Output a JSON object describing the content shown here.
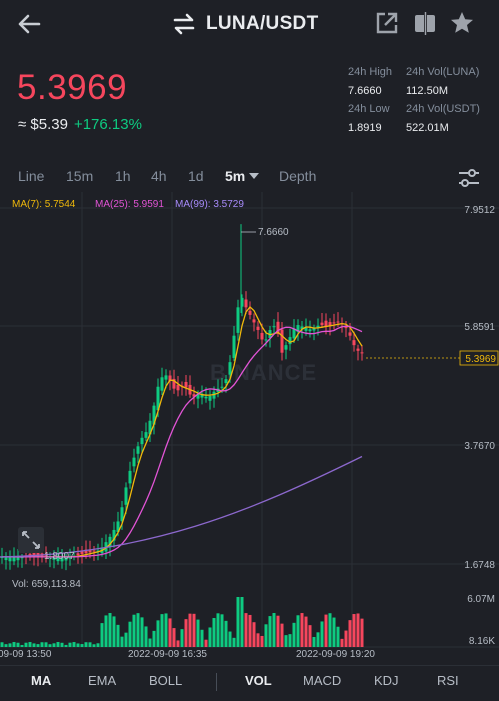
{
  "header": {
    "pair": "LUNA/USDT"
  },
  "ticker": {
    "price": "5.3969",
    "usd_approx": "≈ $5.39",
    "change": "+176.13%",
    "stats": [
      {
        "label": "24h High",
        "value": "7.6660"
      },
      {
        "label": "24h Vol(LUNA)",
        "value": "112.50M"
      },
      {
        "label": "24h Low",
        "value": "1.8919"
      },
      {
        "label": "24h Vol(USDT)",
        "value": "522.01M"
      }
    ]
  },
  "intervals": [
    "Line",
    "15m",
    "1h",
    "4h",
    "1d",
    "5m",
    "Depth"
  ],
  "active_interval": "5m",
  "chart_data": {
    "type": "candlestick",
    "ma_labels": [
      "MA(7): 5.7544",
      "MA(25): 5.9591",
      "MA(99): 3.5729"
    ],
    "price_axis": [
      "7.9512",
      "5.8591",
      "3.7670",
      "1.6748"
    ],
    "current_price_tag": "5.3969",
    "high_marker": "7.6660",
    "low_marker": "1.8007",
    "volume_label": "Vol: 659,113.84",
    "volume_axis": [
      "6.07M",
      "8.16K"
    ],
    "time_axis": [
      "09-09 13:50",
      "2022-09-09 16:35",
      "2022-09-09 19:20"
    ],
    "watermark": "BINANCE",
    "ylim": [
      1.6748,
      7.9512
    ],
    "colors": {
      "up": "#0ecb81",
      "down": "#f6465d",
      "ma7": "#f0b90b",
      "ma25": "#e254d6",
      "ma99": "#8c68cd"
    }
  },
  "bottom_tabs": [
    "MA",
    "EMA",
    "BOLL",
    "VOL",
    "MACD",
    "KDJ",
    "RSI"
  ]
}
